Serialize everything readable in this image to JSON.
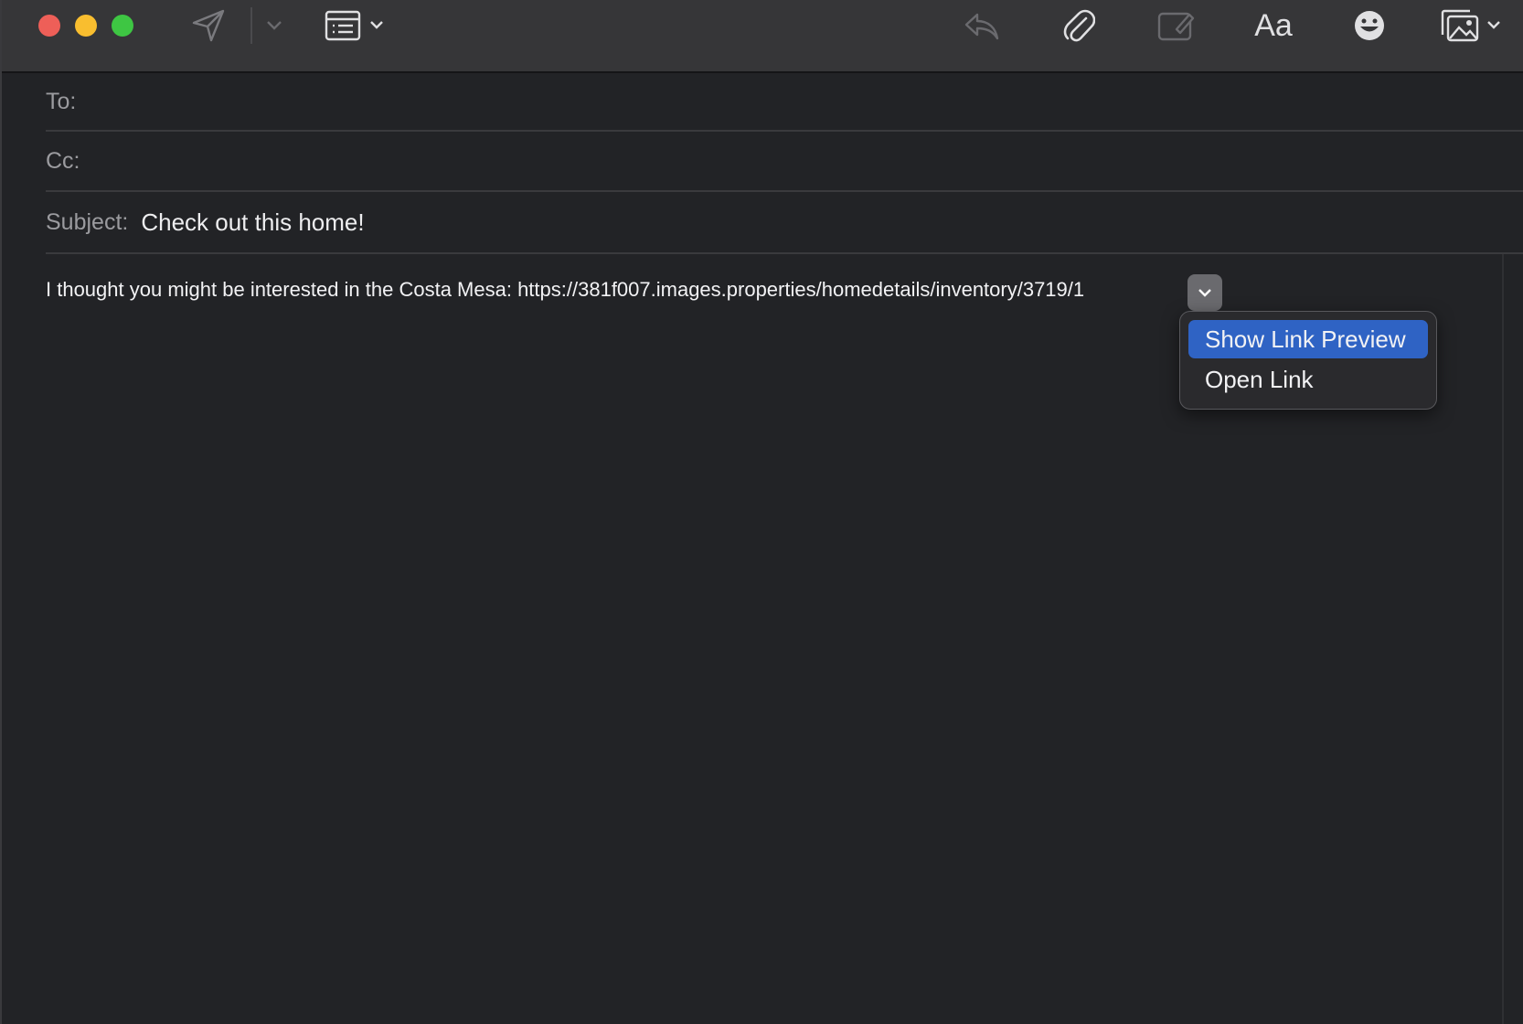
{
  "toolbar": {
    "icons": [
      "send-icon",
      "chevron-down-icon",
      "header-fields-icon",
      "reply-icon",
      "paperclip-icon",
      "markup-icon",
      "emoji-icon",
      "photo-browser-icon"
    ],
    "format_label": "Aa"
  },
  "fields": {
    "to_label": "To:",
    "to_value": "",
    "cc_label": "Cc:",
    "cc_value": "",
    "subject_label": "Subject:",
    "subject_value": "Check out this home!"
  },
  "body": {
    "text": "I thought you might be interested in the Costa Mesa: https://381f007.images.properties/homedetails/inventory/3719/1"
  },
  "link_menu": {
    "items": [
      {
        "label": "Show Link Preview",
        "highlighted": true
      },
      {
        "label": "Open Link",
        "highlighted": false
      }
    ]
  },
  "colors": {
    "close": "#ee5f58",
    "minimize": "#f9be2f",
    "maximize": "#3ec643",
    "highlight": "#2f63c4"
  }
}
